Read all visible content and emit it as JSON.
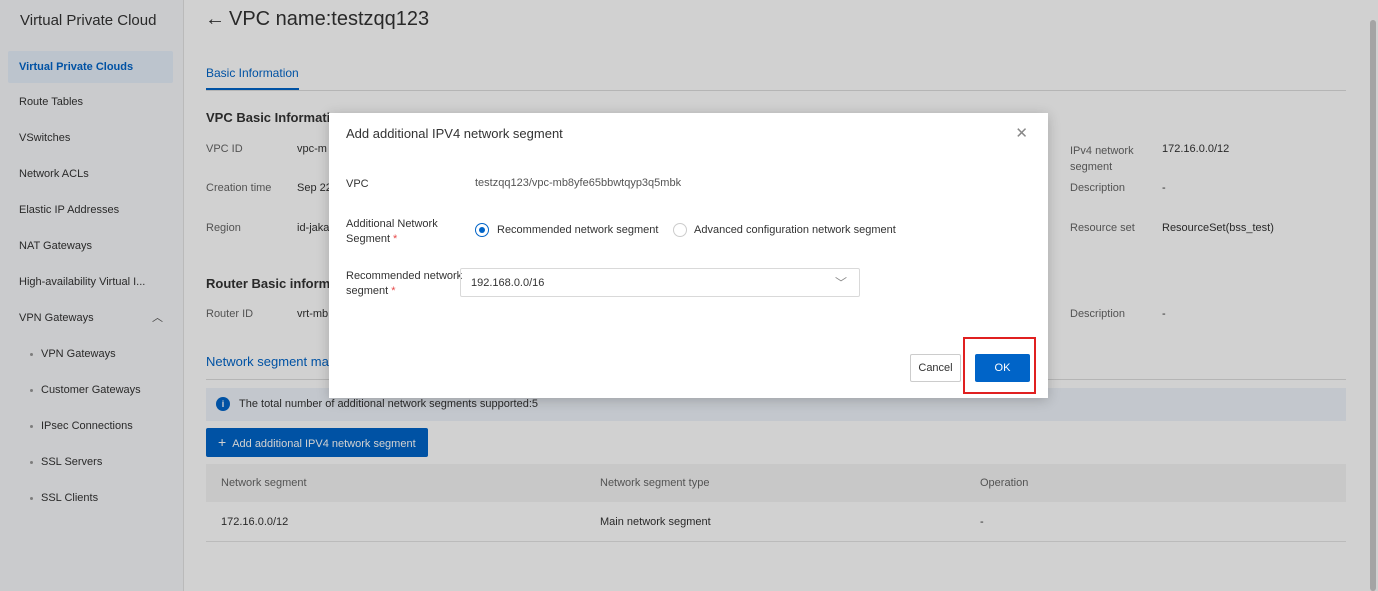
{
  "sidebar": {
    "title": "Virtual Private Cloud",
    "items": [
      {
        "label": "Virtual Private Clouds"
      },
      {
        "label": "Route Tables"
      },
      {
        "label": "VSwitches"
      },
      {
        "label": "Network ACLs"
      },
      {
        "label": "Elastic IP Addresses"
      },
      {
        "label": "NAT Gateways"
      },
      {
        "label": "High-availability Virtual I..."
      },
      {
        "label": "VPN Gateways"
      },
      {
        "label": "VPN Gateways"
      },
      {
        "label": "Customer Gateways"
      },
      {
        "label": "IPsec Connections"
      },
      {
        "label": "SSL Servers"
      },
      {
        "label": "SSL Clients"
      }
    ]
  },
  "header": {
    "back_icon": "←",
    "title": "VPC name:testzqq123"
  },
  "tabs": {
    "basic": "Basic Information"
  },
  "vpc_basic": {
    "title": "VPC Basic Informatio",
    "vpc_id_label": "VPC ID",
    "vpc_id_value": "vpc-m",
    "creation_label": "Creation time",
    "creation_value": "Sep 22",
    "region_label": "Region",
    "region_value": "id-jaka",
    "ipv4_label": "IPv4 network segment",
    "ipv4_value": "172.16.0.0/12",
    "description_label": "Description",
    "description_value": "-",
    "resource_label": "Resource set",
    "resource_value": "ResourceSet(bss_test)"
  },
  "router_basic": {
    "title": "Router Basic informa",
    "router_id_label": "Router ID",
    "router_id_value": "vrt-mb",
    "description_label": "Description",
    "description_value": "-"
  },
  "segment": {
    "tab_label": "Network segment ma",
    "info_text": "The total number of additional network segments supported:5",
    "add_button": "Add additional IPV4 network segment",
    "columns": [
      "Network segment",
      "Network segment type",
      "Operation"
    ],
    "rows": [
      {
        "segment": "172.16.0.0/12",
        "type": "Main network segment",
        "operation": "-"
      }
    ]
  },
  "dialog": {
    "title": "Add additional IPV4 network segment",
    "vpc_label": "VPC",
    "vpc_value": "testzqq123/vpc-mb8yfe65bbwtqyp3q5mbk",
    "additional_label_1": "Additional Network",
    "additional_label_2": "Segment",
    "radio_recommended": "Recommended network segment",
    "radio_advanced": "Advanced configuration network segment",
    "recommended_label_1": "Recommended network",
    "recommended_label_2": "segment",
    "required_mark": "*",
    "select_value": "192.168.0.0/16",
    "cancel": "Cancel",
    "ok": "OK"
  }
}
